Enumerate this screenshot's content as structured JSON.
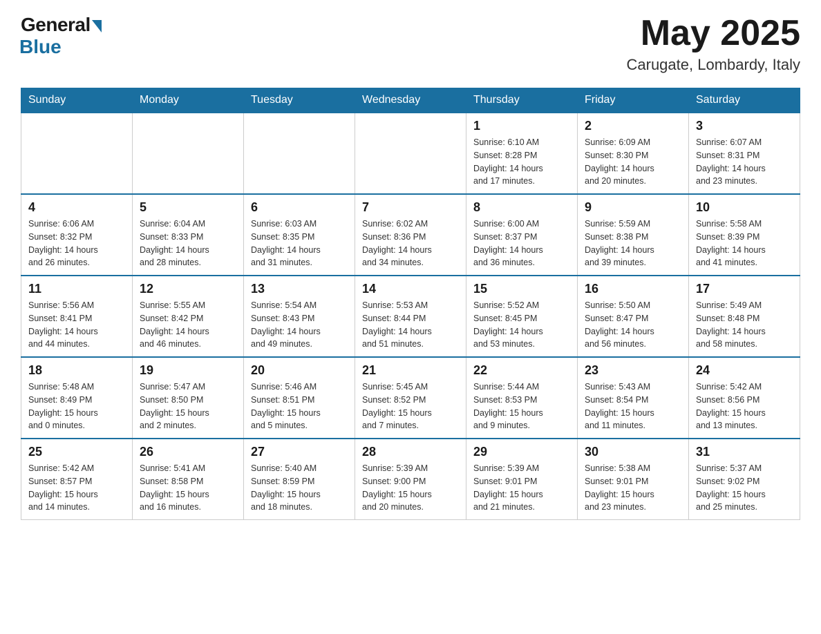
{
  "header": {
    "logo_general": "General",
    "logo_blue": "Blue",
    "month_year": "May 2025",
    "location": "Carugate, Lombardy, Italy"
  },
  "days_of_week": [
    "Sunday",
    "Monday",
    "Tuesday",
    "Wednesday",
    "Thursday",
    "Friday",
    "Saturday"
  ],
  "weeks": [
    [
      {
        "day": "",
        "info": ""
      },
      {
        "day": "",
        "info": ""
      },
      {
        "day": "",
        "info": ""
      },
      {
        "day": "",
        "info": ""
      },
      {
        "day": "1",
        "info": "Sunrise: 6:10 AM\nSunset: 8:28 PM\nDaylight: 14 hours\nand 17 minutes."
      },
      {
        "day": "2",
        "info": "Sunrise: 6:09 AM\nSunset: 8:30 PM\nDaylight: 14 hours\nand 20 minutes."
      },
      {
        "day": "3",
        "info": "Sunrise: 6:07 AM\nSunset: 8:31 PM\nDaylight: 14 hours\nand 23 minutes."
      }
    ],
    [
      {
        "day": "4",
        "info": "Sunrise: 6:06 AM\nSunset: 8:32 PM\nDaylight: 14 hours\nand 26 minutes."
      },
      {
        "day": "5",
        "info": "Sunrise: 6:04 AM\nSunset: 8:33 PM\nDaylight: 14 hours\nand 28 minutes."
      },
      {
        "day": "6",
        "info": "Sunrise: 6:03 AM\nSunset: 8:35 PM\nDaylight: 14 hours\nand 31 minutes."
      },
      {
        "day": "7",
        "info": "Sunrise: 6:02 AM\nSunset: 8:36 PM\nDaylight: 14 hours\nand 34 minutes."
      },
      {
        "day": "8",
        "info": "Sunrise: 6:00 AM\nSunset: 8:37 PM\nDaylight: 14 hours\nand 36 minutes."
      },
      {
        "day": "9",
        "info": "Sunrise: 5:59 AM\nSunset: 8:38 PM\nDaylight: 14 hours\nand 39 minutes."
      },
      {
        "day": "10",
        "info": "Sunrise: 5:58 AM\nSunset: 8:39 PM\nDaylight: 14 hours\nand 41 minutes."
      }
    ],
    [
      {
        "day": "11",
        "info": "Sunrise: 5:56 AM\nSunset: 8:41 PM\nDaylight: 14 hours\nand 44 minutes."
      },
      {
        "day": "12",
        "info": "Sunrise: 5:55 AM\nSunset: 8:42 PM\nDaylight: 14 hours\nand 46 minutes."
      },
      {
        "day": "13",
        "info": "Sunrise: 5:54 AM\nSunset: 8:43 PM\nDaylight: 14 hours\nand 49 minutes."
      },
      {
        "day": "14",
        "info": "Sunrise: 5:53 AM\nSunset: 8:44 PM\nDaylight: 14 hours\nand 51 minutes."
      },
      {
        "day": "15",
        "info": "Sunrise: 5:52 AM\nSunset: 8:45 PM\nDaylight: 14 hours\nand 53 minutes."
      },
      {
        "day": "16",
        "info": "Sunrise: 5:50 AM\nSunset: 8:47 PM\nDaylight: 14 hours\nand 56 minutes."
      },
      {
        "day": "17",
        "info": "Sunrise: 5:49 AM\nSunset: 8:48 PM\nDaylight: 14 hours\nand 58 minutes."
      }
    ],
    [
      {
        "day": "18",
        "info": "Sunrise: 5:48 AM\nSunset: 8:49 PM\nDaylight: 15 hours\nand 0 minutes."
      },
      {
        "day": "19",
        "info": "Sunrise: 5:47 AM\nSunset: 8:50 PM\nDaylight: 15 hours\nand 2 minutes."
      },
      {
        "day": "20",
        "info": "Sunrise: 5:46 AM\nSunset: 8:51 PM\nDaylight: 15 hours\nand 5 minutes."
      },
      {
        "day": "21",
        "info": "Sunrise: 5:45 AM\nSunset: 8:52 PM\nDaylight: 15 hours\nand 7 minutes."
      },
      {
        "day": "22",
        "info": "Sunrise: 5:44 AM\nSunset: 8:53 PM\nDaylight: 15 hours\nand 9 minutes."
      },
      {
        "day": "23",
        "info": "Sunrise: 5:43 AM\nSunset: 8:54 PM\nDaylight: 15 hours\nand 11 minutes."
      },
      {
        "day": "24",
        "info": "Sunrise: 5:42 AM\nSunset: 8:56 PM\nDaylight: 15 hours\nand 13 minutes."
      }
    ],
    [
      {
        "day": "25",
        "info": "Sunrise: 5:42 AM\nSunset: 8:57 PM\nDaylight: 15 hours\nand 14 minutes."
      },
      {
        "day": "26",
        "info": "Sunrise: 5:41 AM\nSunset: 8:58 PM\nDaylight: 15 hours\nand 16 minutes."
      },
      {
        "day": "27",
        "info": "Sunrise: 5:40 AM\nSunset: 8:59 PM\nDaylight: 15 hours\nand 18 minutes."
      },
      {
        "day": "28",
        "info": "Sunrise: 5:39 AM\nSunset: 9:00 PM\nDaylight: 15 hours\nand 20 minutes."
      },
      {
        "day": "29",
        "info": "Sunrise: 5:39 AM\nSunset: 9:01 PM\nDaylight: 15 hours\nand 21 minutes."
      },
      {
        "day": "30",
        "info": "Sunrise: 5:38 AM\nSunset: 9:01 PM\nDaylight: 15 hours\nand 23 minutes."
      },
      {
        "day": "31",
        "info": "Sunrise: 5:37 AM\nSunset: 9:02 PM\nDaylight: 15 hours\nand 25 minutes."
      }
    ]
  ]
}
